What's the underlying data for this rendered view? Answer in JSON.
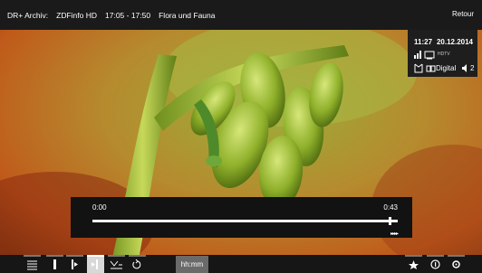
{
  "topbar": {
    "archive_label": "DR+ Archiv:",
    "channel": "ZDFinfo HD",
    "time_range": "17:05 - 17:50",
    "program_title": "Flora und Fauna",
    "back_label": "Retour"
  },
  "infobox": {
    "time": "11:27",
    "date": "20.12.2014",
    "hdtv_label": "HDTV",
    "reception": "Digital",
    "audio_channels": "2"
  },
  "progress": {
    "start_time": "0:00",
    "end_time": "0:43",
    "position_fraction": 0.975,
    "speed_indicator": "▸▸▸▸"
  },
  "bottombar": {
    "time_input_placeholder": "hh:mm",
    "items": [
      {
        "icon": "list-icon"
      },
      {
        "icon": "bookmark-icon"
      },
      {
        "icon": "bookmark-back-icon"
      },
      {
        "icon": "bookmark-forward-icon"
      },
      {
        "icon": "subtitle-icon"
      },
      {
        "icon": "repeat-icon"
      },
      {
        "icon": "star-icon"
      },
      {
        "icon": "info-icon"
      },
      {
        "icon": "settings-icon"
      }
    ]
  },
  "colors": {
    "bar_background": "#1a1a1a",
    "progress_panel": "#121212",
    "active_button": "#d8d8d8",
    "time_input": "#6a6a6a"
  }
}
